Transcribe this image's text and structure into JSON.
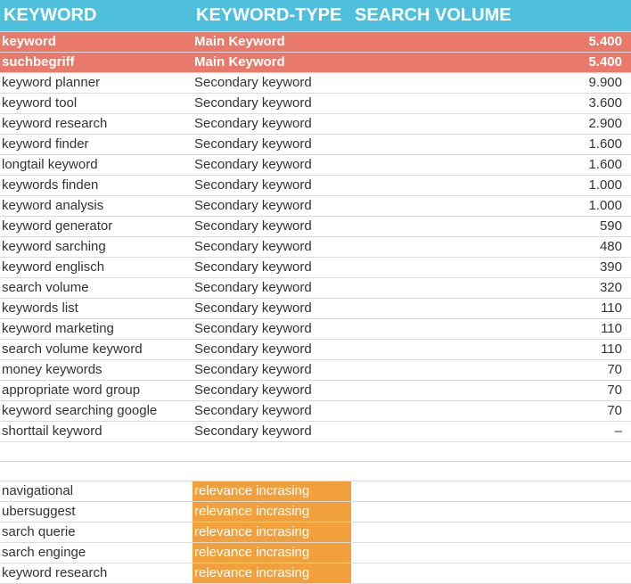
{
  "headers": {
    "keyword": "KEYWORD",
    "type": "KEYWORD-TYPE",
    "volume": "SEARCH VOLUME"
  },
  "rows": [
    {
      "keyword": "keyword",
      "type": "Main Keyword",
      "volume": "5.400",
      "style": "main"
    },
    {
      "keyword": "suchbegriff",
      "type": "Main Keyword",
      "volume": "5.400",
      "style": "main"
    },
    {
      "keyword": "keyword planner",
      "type": "Secondary keyword",
      "volume": "9.900",
      "style": "secondary"
    },
    {
      "keyword": "keyword tool",
      "type": "Secondary keyword",
      "volume": "3.600",
      "style": "secondary"
    },
    {
      "keyword": "keyword research",
      "type": "Secondary keyword",
      "volume": "2.900",
      "style": "secondary"
    },
    {
      "keyword": "keyword finder",
      "type": "Secondary keyword",
      "volume": "1.600",
      "style": "secondary"
    },
    {
      "keyword": "longtail keyword",
      "type": "Secondary keyword",
      "volume": "1.600",
      "style": "secondary"
    },
    {
      "keyword": "keywords finden",
      "type": "Secondary keyword",
      "volume": "1.000",
      "style": "secondary"
    },
    {
      "keyword": "keyword analysis",
      "type": "Secondary keyword",
      "volume": "1.000",
      "style": "secondary"
    },
    {
      "keyword": "keyword generator",
      "type": "Secondary keyword",
      "volume": "590",
      "style": "secondary"
    },
    {
      "keyword": "keyword sarching",
      "type": "Secondary keyword",
      "volume": "480",
      "style": "secondary"
    },
    {
      "keyword": "keyword englisch",
      "type": "Secondary keyword",
      "volume": "390",
      "style": "secondary"
    },
    {
      "keyword": "search volume",
      "type": "Secondary keyword",
      "volume": "320",
      "style": "secondary"
    },
    {
      "keyword": "keywords list",
      "type": "Secondary keyword",
      "volume": "110",
      "style": "secondary"
    },
    {
      "keyword": "keyword marketing",
      "type": "Secondary keyword",
      "volume": "110",
      "style": "secondary"
    },
    {
      "keyword": "search volume keyword",
      "type": "Secondary keyword",
      "volume": "110",
      "style": "secondary"
    },
    {
      "keyword": "money keywords",
      "type": "Secondary keyword",
      "volume": "70",
      "style": "secondary"
    },
    {
      "keyword": "appropriate word group",
      "type": "Secondary keyword",
      "volume": "70",
      "style": "secondary"
    },
    {
      "keyword": "keyword searching google",
      "type": "Secondary keyword",
      "volume": "70",
      "style": "secondary"
    },
    {
      "keyword": "shorttail keyword",
      "type": "Secondary keyword",
      "volume": "–",
      "style": "secondary"
    },
    {
      "keyword": "",
      "type": "",
      "volume": "",
      "style": "empty"
    },
    {
      "keyword": "",
      "type": "",
      "volume": "",
      "style": "empty"
    },
    {
      "keyword": "navigational",
      "type": "relevance incrasing",
      "volume": "",
      "style": "relevance"
    },
    {
      "keyword": "ubersuggest",
      "type": "relevance incrasing",
      "volume": "",
      "style": "relevance"
    },
    {
      "keyword": "sarch querie",
      "type": "relevance incrasing",
      "volume": "",
      "style": "relevance"
    },
    {
      "keyword": "sarch enginge",
      "type": "relevance incrasing",
      "volume": "",
      "style": "relevance"
    },
    {
      "keyword": "keyword research",
      "type": "relevance incrasing",
      "volume": "",
      "style": "relevance"
    }
  ]
}
